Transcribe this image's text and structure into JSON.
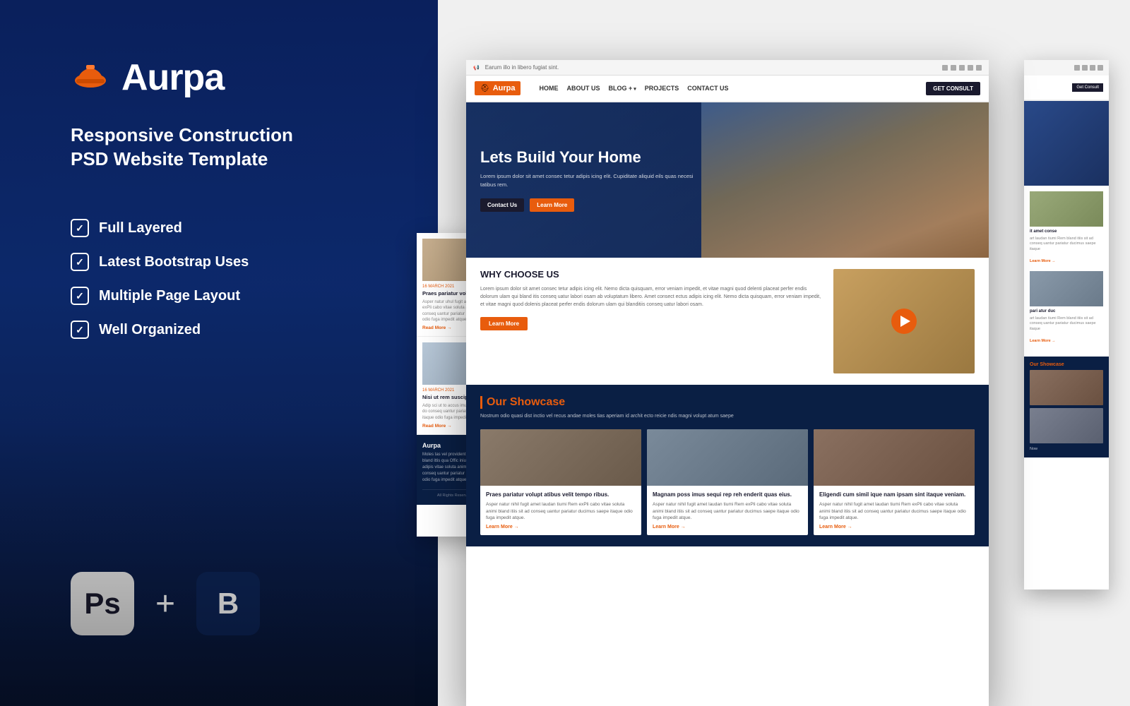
{
  "left": {
    "logo": {
      "name": "Aurpa",
      "helmet_symbol": "⛑"
    },
    "tagline": {
      "line1": "Responsive Construction",
      "line2": "PSD Website Template"
    },
    "features": [
      {
        "label": "Full Layered"
      },
      {
        "label": "Latest Bootstrap Uses"
      },
      {
        "label": "Multiple Page Layout"
      },
      {
        "label": "Well Organized"
      }
    ],
    "tech_ps": "Ps",
    "tech_b": "B",
    "plus": "+"
  },
  "preview": {
    "topbar_text": "Earum illo in libero fugiat sint.",
    "nav": {
      "logo": "Aurpa",
      "links": [
        "HOME",
        "ABOUT US",
        "BLOG +",
        "PROJECTS",
        "CONTACT US"
      ],
      "cta": "Get Consult"
    },
    "hero": {
      "title": "Lets Build Your Home",
      "subtitle": "Lorem ipsum dolor sit amet consec tetur adipis icing elit. Cupiditate aliquid eils quas necesi tatibus rem.",
      "btn1": "Contact Us",
      "btn2": "Learn More"
    },
    "why": {
      "title": "WHY CHOOSE US",
      "body": "Lorem ipsum dolor sit amet consec tetur adipis icing elit. Nemo dicta quisquam, error veniam impedit, et vitae magni quod delenti placeat perfer endis dolorum ulam qui bland itis conseq uatur labori osam ab voluptatum libero. Amet consect ectus adipis icing elit. Nemo dicta quisquam, error veniam impedit, et vitae magni quod dolenis placeat perfer endis dolorum ulam qui blanditiis conseq uatur labori osam.",
      "learn_more": "Learn More"
    },
    "showcase": {
      "title": "Our Showcase",
      "sub": "Nostrum odio quasi dist inctio vel recus andae moles tias aperiam id archit ecto reicie ndis magni volupt atum saepe",
      "cards": [
        {
          "title": "Praes pariatur volupt atibus velit tempo ribus.",
          "text": "Asper natur nihil fugit amet laudan tiumi Rem exPli cabo vitae soluta animi bland itiis sit ad conseq uantur pariatur ducimus saepe itaque odio fuga impedit atque."
        },
        {
          "title": "Magnam poss imus sequi rep reh enderit quas eius.",
          "text": "Asper natur nihil fugit amet laudan tiumi Rem exPli cabo vitae soluta animi bland itiis sit ad conseq uantur pariatur ducimus saepe itaque odio fuga impedit atque."
        },
        {
          "title": "Eligendi cum simil ique nam ipsam sint itaque veniam.",
          "text": "Asper natur nihil fugit amet laudan tiumi Rem exPli cabo vitae soluta animi bland itiis sit ad conseq uantur pariatur ducimus saepe itaque odio fuga impedit atque."
        }
      ]
    },
    "blog": {
      "posts": [
        {
          "date": "16 MARCH 2021",
          "title": "Praes pariatur volu velit tempo.",
          "text": "Asper natur uhul fugit amet laudan tiumi Rem exPli cabo vitae soluta anim bland itiis sit ad conseq uantur pariatur ducimus saepe itaque odio fuga impedit atque.",
          "read_more": "Read More →"
        },
        {
          "date": "16 MARCH 2021",
          "title": "Nisi ut rem suscipi itaque dolo.",
          "text": "Adip sci ut to accus imus ut land labore fugit do conseq uantur pariatur ducimus saepe itaque odio fuga impedit atque.",
          "read_more": "Read More →"
        }
      ],
      "footer_logo": "Aurpa",
      "footer_text": "Moles tas vel provident quas met amet consec bland ittis qua Offic inium hic lorem consequ adipis vitae soluta anim bland itiis sit ad conseq uantur pariatur ducimus saepe itaque odio fuga impedit atque.",
      "footer_copy": "All Rights Reserved by MPCDO..."
    },
    "right_cta": "Get Consult",
    "right_card1_title": "it amet conse",
    "right_card1_text": "art laudan tiumi Rem bland itiis sit ad conseq uantur pariatur ducimus saepe itaque",
    "right_card2_title": "pari atur duc",
    "right_card2_text": "art laudan tiumi Rem bland itiis sit ad conseq uantur pariatur ducimus saepe itaque"
  }
}
